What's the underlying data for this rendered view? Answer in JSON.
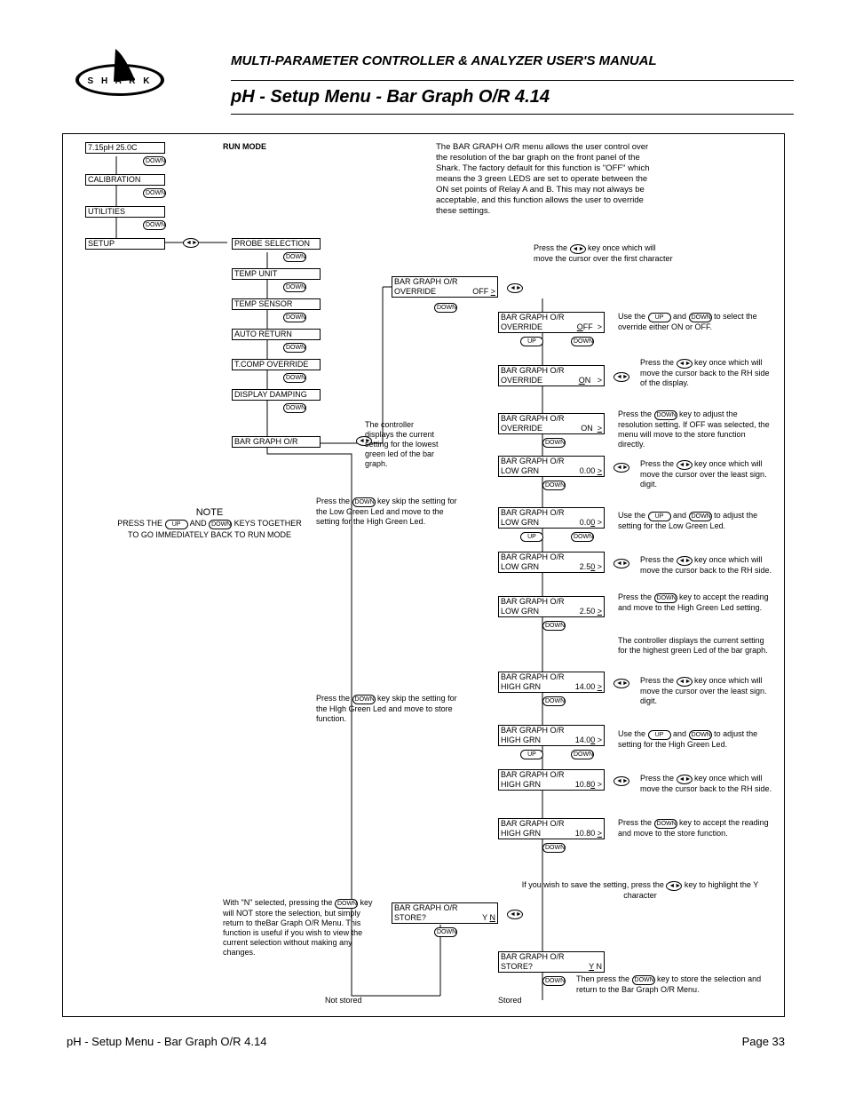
{
  "logo_letters": "S H A R K",
  "header": "MULTI-PARAMETER CONTROLLER & ANALYZER USER'S MANUAL",
  "title": "pH - Setup Menu - Bar Graph O/R 4.14",
  "footer_left": "pH - Setup Menu - Bar Graph O/R 4.14",
  "footer_right": "Page 33",
  "run_mode": "RUN MODE",
  "intro": "The BAR GRAPH O/R menu allows the user control over the resolution of the bar graph on the front panel of the Shark. The factory default for this function is \"OFF\" which means the 3  green LEDS are set to operate between the ON set points of Relay A and B.  This may not always be acceptable, and this function allows the user to override these settings.",
  "menu": {
    "top": "7.15pH  25.0C",
    "calibration": "CALIBRATION",
    "utilities": "UTILITIES",
    "setup": "SETUP"
  },
  "sub": {
    "probe": "PROBE SELECTION",
    "temp_unit": "TEMP UNIT",
    "temp_sensor": "TEMP SENSOR",
    "auto_return": "AUTO RETURN",
    "tcomp": "T.COMP OVERRIDE",
    "damping": "DISPLAY DAMPING",
    "bargraph": "BAR GRAPH O/R"
  },
  "screens": {
    "bgo": "BAR GRAPH O/R",
    "override": "OVERRIDE",
    "off": "OFF",
    "on": "ON",
    "low_grn": "LOW GRN",
    "high_grn": "HIGH GRN",
    "store": "STORE?",
    "yn_y": "Y",
    "yn_n": "N",
    "v000": "0.00",
    "v000b": "0.00 >",
    "v250": "2.50 >",
    "v250b": "2.50",
    "v1400": "14.00",
    "v1400b": "14.00 >",
    "v1080": "10.80 >",
    "v1080b": "10.80",
    "gt": ">"
  },
  "notes": {
    "title": "NOTE",
    "body1": "PRESS THE ",
    "body2": " AND ",
    "body3": " KEYS TOGETHER TO GO IMMEDIATELY BACK TO RUN MODE"
  },
  "side": {
    "s1a": "Press the ",
    "s1b": " key once which will move the cursor over the first character",
    "s2a": "Use the ",
    "s2b": " and ",
    "s2c": " to select the override either ON or OFF.",
    "s3a": "Press the ",
    "s3b": " key once which will move the cursor back to the RH side of the display.",
    "s4a": "Press the ",
    "s4b": " key to adjust the resolution setting. If OFF was selected, the menu will move to the store function directly.",
    "s5a": "Press the ",
    "s5b": " key once which will move the cursor over the least sign. digit.",
    "s6a": "Use the ",
    "s6b": " and ",
    "s6c": " to adjust the setting for the Low Green Led.",
    "s7a": "Press the ",
    "s7b": " key once which will move the cursor back to the RH side.",
    "s8a": "Press the ",
    "s8b": " key to accept the reading and move to the High Green Led setting.",
    "s9": "The controller displays the current setting for the highest green Led of the bar graph.",
    "s10a": "Press the ",
    "s10b": " key once which will move the cursor over the least sign. digit.",
    "s11a": "Use the ",
    "s11b": " and ",
    "s11c": " to adjust the setting for the High Green Led.",
    "s12a": "Press the ",
    "s12b": " key once which will move the cursor back to the RH side.",
    "s13a": "Press the ",
    "s13b": " key to accept the reading and move to the store function.",
    "s14a": "If you wish to save the setting, press the ",
    "s14b": " key to highlight the Y character",
    "s15a": "Then press the ",
    "s15b": " key to store the selection and return to the Bar Graph O/R Menu.",
    "left1": "The controller displays the current setting for the lowest green led of the bar graph.",
    "left2a": "Press the ",
    "left2b": " key skip the setting for the Low Green Led and move to the setting for the High Green Led.",
    "left3a": "Press the ",
    "left3b": " key skip the setting for the HIgh Green Led and move to store function.",
    "left4": "With \"N\" selected, pressing the ",
    "left4b": " key will NOT store the selection, but simply return to theBar Graph O/R Menu. This function is useful if you wish to view the current selection without making any changes.",
    "not_stored": "Not stored",
    "stored": "Stored"
  },
  "btns": {
    "down": "DOWN",
    "up": "UP",
    "lr": "◄►"
  }
}
